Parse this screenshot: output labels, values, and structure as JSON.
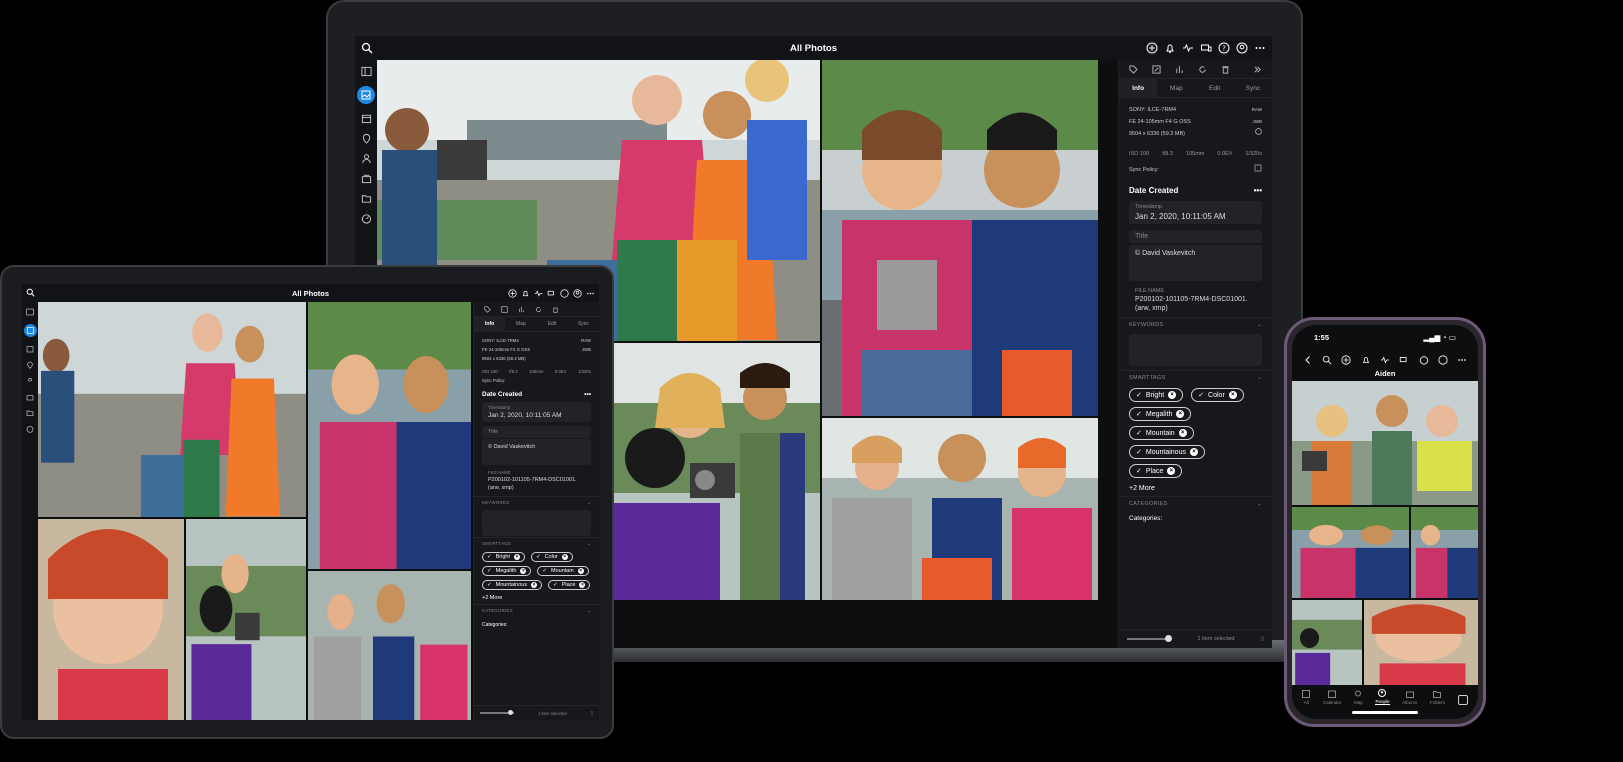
{
  "laptop": {
    "title": "All Photos",
    "panel": {
      "tabs": [
        "Info",
        "Map",
        "Edit",
        "Sync"
      ],
      "camera": "SONY: ILCE-7RM4",
      "raw_badge": "RAW",
      "lens": "FE 24-105mm F4 G OSS",
      "jpg_badge": "JWB",
      "dimensions": "9504 x 6336 (59.3 MB)",
      "exif": [
        "ISO 100",
        "f/8.3",
        "105mm",
        "0.0EV",
        "1/320s"
      ],
      "sync_policy": "Sync Policy:",
      "date_created": "Date Created",
      "timestamp_label": "Timestamp",
      "timestamp_value": "Jan 2, 2020, 10:11:05 AM",
      "title_label": "Title",
      "caption_value": "© David Vaskevitch",
      "file_name_label": "FILE NAME",
      "file_name_value": "P200102-101105-7RM4-DSC01001.",
      "file_name_ext": "(arw, xmp)",
      "keywords_label": "KEYWORDS",
      "smarttags_label": "SMARTTAGS",
      "chips": [
        "Bright",
        "Color",
        "Megalith",
        "Mountain",
        "Mountainous",
        "Place"
      ],
      "more": "+2 More",
      "categories_label": "CATEGORIES",
      "categories_field": "Categories:",
      "selected": "1 item selected"
    }
  },
  "tablet": {
    "title": "All Photos",
    "panel": {
      "tabs": [
        "Info",
        "Map",
        "Edit",
        "Sync"
      ],
      "camera": "SONY: ILCE-7RM4",
      "raw_badge": "RAW",
      "lens": "FE 24-105mm F4 G OSS",
      "jpg_badge": "JWB",
      "dimensions": "9504 x 6336 (59.3 MB)",
      "exif": [
        "ISO 100",
        "f/8.3",
        "105mm",
        "0.0EV",
        "1/320s"
      ],
      "sync_policy": "Sync Policy:",
      "date_created": "Date Created",
      "timestamp_label": "Timestamp",
      "timestamp_value": "Jan 2, 2020, 10:11:05 AM",
      "title_label": "Title",
      "caption_value": "© David Vaskevitch",
      "file_name_label": "FILE NAME",
      "file_name_value": "P200102-101105-7RM4-DSC01001.",
      "file_name_ext": "(arw, xmp)",
      "keywords_label": "KEYWORDS",
      "smarttags_label": "SMARTTAGS",
      "chips": [
        "Bright",
        "Color",
        "Megalith",
        "Mountain",
        "Mountainous",
        "Place"
      ],
      "more": "+2 More",
      "categories_label": "CATEGORIES",
      "categories_field": "Categories:",
      "selected": "1 item selected"
    }
  },
  "phone": {
    "time": "1:55",
    "title": "Aiden",
    "tabs": [
      "All",
      "Calendar",
      "Map",
      "People",
      "Albums",
      "Folders"
    ],
    "selected_tab": "People"
  },
  "colors": {
    "accent": "#1e88e5",
    "panel_bg": "#17181b",
    "screen_bg": "#0d0e10"
  }
}
